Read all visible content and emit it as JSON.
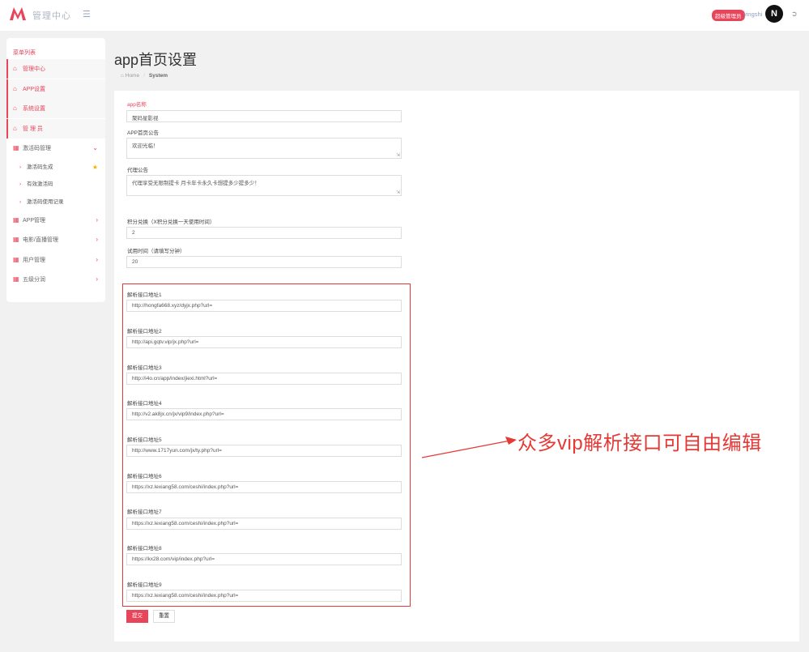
{
  "header": {
    "brand": "管理中心",
    "role_badge": "超级管理员",
    "username": "yingshi",
    "avatar_letter": "N",
    "accent_color": "#e8445a"
  },
  "sidebar": {
    "title": "菜单列表",
    "items": [
      {
        "label": "管理中心",
        "icon": "home-icon"
      },
      {
        "label": "APP设置",
        "icon": "home-icon"
      },
      {
        "label": "系统设置",
        "icon": "home-icon"
      },
      {
        "label": "管 理 员",
        "icon": "home-icon"
      },
      {
        "label": "激活码管理",
        "icon": "calendar-icon"
      },
      {
        "label": "APP管理",
        "icon": "grid-icon"
      },
      {
        "label": "电影/直播管理",
        "icon": "grid-icon"
      },
      {
        "label": "用户管理",
        "icon": "grid-icon"
      },
      {
        "label": "五级分润",
        "icon": "grid-icon"
      }
    ],
    "subitems": [
      {
        "label": "激活码生成"
      },
      {
        "label": "有效激活码"
      },
      {
        "label": "激活码使用记录"
      }
    ]
  },
  "page": {
    "title": "app首页设置",
    "breadcrumb_home": "Home",
    "breadcrumb_current": "System"
  },
  "form": {
    "app_name_label": "app名称",
    "app_name_value": "聚码星影视",
    "notice_label": "APP首页公告",
    "notice_value": "欢迎光临！",
    "agent_label": "代理公告",
    "agent_value": "代理享受无限制提卡 月卡年卡永久卡想提多少提多少！",
    "points_label": "积分兑换（X积分兑换一天使用时间）",
    "points_value": "2",
    "trial_label": "试用时间（请填写分钟）",
    "trial_value": "20",
    "parsers": [
      {
        "label": "解析接口地址1",
        "value": "http://hongfa668.xyz/dyjx.php?url="
      },
      {
        "label": "解析接口地址2",
        "value": "http://api.gqtv.vip/jx.php?url="
      },
      {
        "label": "解析接口地址3",
        "value": "http://i4o.cn/app/index/jiexi.html?url="
      },
      {
        "label": "解析接口地址4",
        "value": "http://v2.ak8jx.cn/jx/vip9/index.php?url="
      },
      {
        "label": "解析接口地址5",
        "value": "http://www.1717yun.com/jx/ty.php?url="
      },
      {
        "label": "解析接口地址6",
        "value": "https://xz.lexiang58.com/ceshi/index.php?url="
      },
      {
        "label": "解析接口地址7",
        "value": "https://xz.lexiang58.com/ceshi/index.php?url="
      },
      {
        "label": "解析接口地址8",
        "value": "https://kx28.com/vip/index.php?url="
      },
      {
        "label": "解析接口地址9",
        "value": "https://xz.lexiang58.com/ceshi/index.php?url="
      }
    ],
    "submit_label": "提交",
    "reset_label": "重置"
  },
  "annotation": {
    "text": "众多vip解析接口可自由编辑",
    "color": "#e53935"
  }
}
